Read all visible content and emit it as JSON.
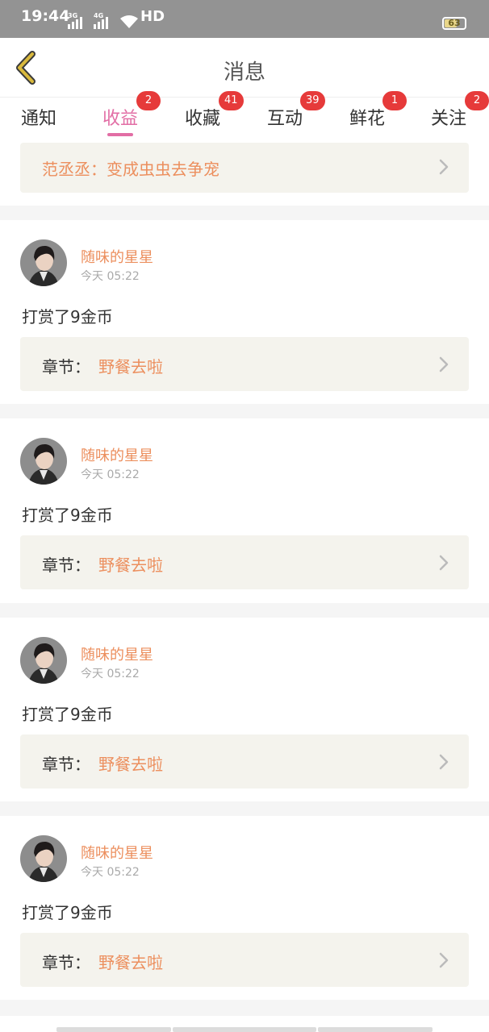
{
  "status_bar": {
    "time": "19:44",
    "signal1_label": "3G",
    "signal2_label": "4G",
    "hd_label": "HD",
    "battery_level": "63"
  },
  "navbar": {
    "title": "消息"
  },
  "tabs": [
    {
      "label": "通知"
    },
    {
      "label": "收益",
      "badge": "2",
      "active": true
    },
    {
      "label": "收藏",
      "badge": "41"
    },
    {
      "label": "互动",
      "badge": "39"
    },
    {
      "label": "鲜花",
      "badge": "1"
    },
    {
      "label": "关注",
      "badge": "2"
    }
  ],
  "previous_item": {
    "text": "范丞丞：变成虫虫去争宠"
  },
  "items": [
    {
      "user": "随味的星星",
      "time": "今天 05:22",
      "action": "打赏了9金币",
      "chapter_label": "章节：",
      "chapter_name": "野餐去啦"
    },
    {
      "user": "随味的星星",
      "time": "今天 05:22",
      "action": "打赏了9金币",
      "chapter_label": "章节：",
      "chapter_name": "野餐去啦"
    },
    {
      "user": "随味的星星",
      "time": "今天 05:22",
      "action": "打赏了9金币",
      "chapter_label": "章节：",
      "chapter_name": "野餐去啦"
    },
    {
      "user": "随味的星星",
      "time": "今天 05:22",
      "action": "打赏了9金币",
      "chapter_label": "章节：",
      "chapter_name": "野餐去啦"
    }
  ],
  "colors": {
    "accent_pink": "#e26ea5",
    "name_orange": "#ec8f5e",
    "badge_red": "#e63a3a",
    "back_arrow": "#d9b93d",
    "card_bg": "#f4f3ed"
  },
  "icons": {
    "back": "back-arrow-icon",
    "chevron": "chevron-right-icon",
    "wifi": "wifi-icon",
    "battery": "battery-icon"
  }
}
